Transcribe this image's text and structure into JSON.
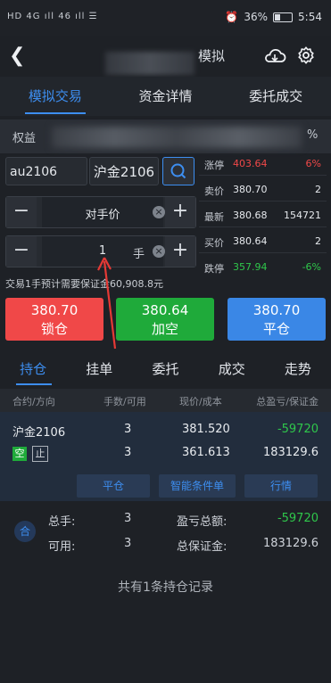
{
  "status_bar": {
    "left": "HD 4G ıll 46 ıll ☰",
    "battery": "36%",
    "time": "5:54"
  },
  "header": {
    "title": "模拟"
  },
  "tabs": [
    {
      "label": "模拟交易"
    },
    {
      "label": "资金详情"
    },
    {
      "label": "委托成交"
    }
  ],
  "account": {
    "label": "权益",
    "trailing": "%"
  },
  "order": {
    "contract_code": "au2106",
    "contract_name": "沪金2106",
    "price_type": "对手价",
    "quantity": "1",
    "quantity_unit": "手",
    "minus": "−",
    "plus": "+",
    "margin_note": "交易1手预计需要保证金60,908.8元"
  },
  "quote": [
    {
      "label": "涨停",
      "price": "403.64",
      "value": "6%",
      "color": "red"
    },
    {
      "label": "卖价",
      "price": "380.70",
      "value": "2",
      "color": "white"
    },
    {
      "label": "最新",
      "price": "380.68",
      "value": "154721",
      "color": "white"
    },
    {
      "label": "买价",
      "price": "380.64",
      "value": "2",
      "color": "white"
    },
    {
      "label": "跌停",
      "price": "357.94",
      "value": "-6%",
      "color": "green"
    }
  ],
  "actions": [
    {
      "price": "380.70",
      "label": "锁仓",
      "color": "#f04848"
    },
    {
      "price": "380.64",
      "label": "加空",
      "color": "#1faa3a"
    },
    {
      "price": "380.70",
      "label": "平仓",
      "color": "#3a87e6"
    }
  ],
  "sub_tabs": [
    {
      "label": "持仓"
    },
    {
      "label": "挂单"
    },
    {
      "label": "委托"
    },
    {
      "label": "成交"
    },
    {
      "label": "走势"
    }
  ],
  "columns": {
    "c1": "合约/方向",
    "c2": "手数/可用",
    "c3": "现价/成本",
    "c4": "总盈亏/保证金"
  },
  "position": {
    "name": "沪金2106",
    "direction": "空",
    "stop": "止",
    "lots": "3",
    "available": "3",
    "current_price": "381.520",
    "cost": "361.613",
    "pnl": "-59720",
    "margin": "183129.6",
    "buttons": [
      "平仓",
      "智能条件单",
      "行情"
    ]
  },
  "summary": {
    "badge": "合",
    "total_lots_label": "总手:",
    "total_lots": "3",
    "available_label": "可用:",
    "available": "3",
    "pnl_label": "盈亏总额:",
    "pnl": "-59720",
    "margin_label": "总保证金:",
    "margin": "183129.6"
  },
  "footer": "共有1条持仓记录"
}
